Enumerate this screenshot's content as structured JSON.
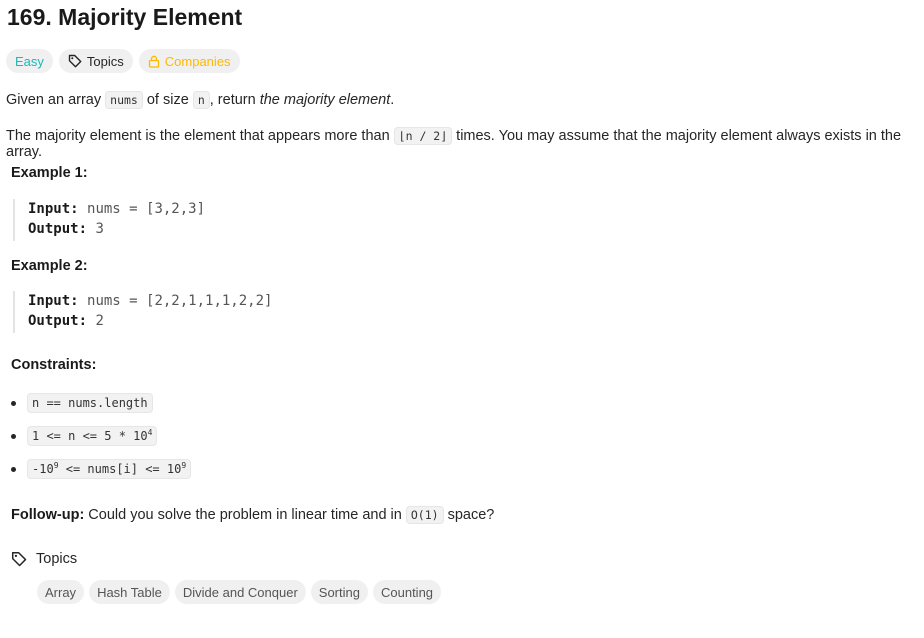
{
  "problem": {
    "title": "169. Majority Element",
    "difficulty": "Easy",
    "topics_label": "Topics",
    "companies_label": "Companies"
  },
  "description": {
    "p1_a": "Given an array ",
    "p1_code1": "nums",
    "p1_b": " of size ",
    "p1_code2": "n",
    "p1_c": ", return ",
    "p1_em": "the majority element",
    "p1_d": ".",
    "p2_a": "The majority element is the element that appears more than ",
    "p2_code": "⌊n / 2⌋",
    "p2_b": " times. You may assume that the majority element always exists in the array."
  },
  "examples": [
    {
      "title": "Example 1:",
      "input_label": "Input:",
      "input_value": "nums = [3,2,3]",
      "output_label": "Output:",
      "output_value": "3"
    },
    {
      "title": "Example 2:",
      "input_label": "Input:",
      "input_value": "nums = [2,2,1,1,1,2,2]",
      "output_label": "Output:",
      "output_value": "2"
    }
  ],
  "constraints": {
    "title": "Constraints:",
    "c1": "n == nums.length",
    "c2_base": "1 <= n <= 5 * 10",
    "c2_sup": "4",
    "c3_a": "-10",
    "c3_sup1": "9",
    "c3_b": " <= nums[i] <= 10",
    "c3_sup2": "9"
  },
  "followup": {
    "label": "Follow-up:",
    "text_a": " Could you solve the problem in linear time and in ",
    "code": "O(1)",
    "text_b": " space?"
  },
  "topics_section": {
    "heading": "Topics",
    "tags": [
      "Array",
      "Hash Table",
      "Divide and Conquer",
      "Sorting",
      "Counting"
    ]
  },
  "colors": {
    "easy": "#1cb8b8",
    "companies": "#ffb800",
    "pill_bg": "#f0f0f0"
  },
  "icons": {
    "topics": "tag-icon",
    "companies": "lock-icon"
  }
}
